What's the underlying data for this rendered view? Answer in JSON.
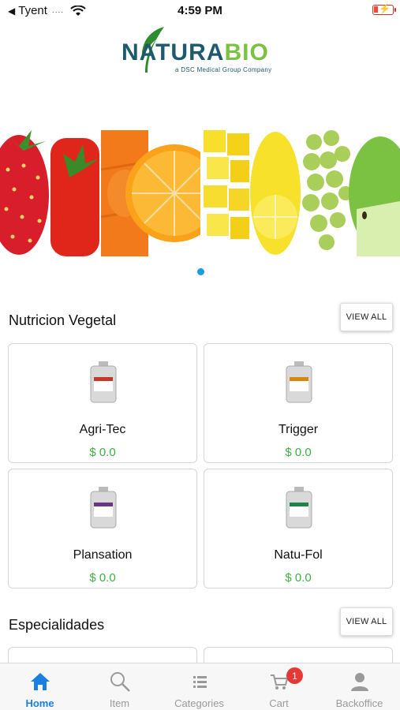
{
  "status_bar": {
    "carrier": "Tyent",
    "signal_dots": "....",
    "time": "4:59 PM"
  },
  "logo": {
    "brand_left": "NATURA",
    "brand_right": "BIO",
    "tagline": "a DSC Medical Group Company",
    "colors": {
      "primary": "#1d5a6e",
      "accent": "#7cc242"
    }
  },
  "banner": {
    "icon": "fruit-banner-image",
    "slides_total": 1,
    "active_slide": 1
  },
  "sections": [
    {
      "title": "Nutricion Vegetal",
      "view_all_label": "VIEW ALL",
      "products": [
        {
          "name": "Agri-Tec",
          "price": "$ 0.0",
          "label_color": "#c0392b"
        },
        {
          "name": "Trigger",
          "price": "$ 0.0",
          "label_color": "#d68910"
        },
        {
          "name": "Plansation",
          "price": "$ 0.0",
          "label_color": "#6c3483"
        },
        {
          "name": "Natu-Fol",
          "price": "$ 0.0",
          "label_color": "#1e8449"
        }
      ]
    },
    {
      "title": "Especialidades",
      "view_all_label": "VIEW ALL",
      "products": []
    }
  ],
  "tab_bar": {
    "active_color": "#1a7fe0",
    "tabs": [
      {
        "label": "Home",
        "icon": "home-icon",
        "active": true
      },
      {
        "label": "Item",
        "icon": "search-icon",
        "active": false
      },
      {
        "label": "Categories",
        "icon": "list-icon",
        "active": false
      },
      {
        "label": "Cart",
        "icon": "cart-icon",
        "active": false,
        "badge": "1"
      },
      {
        "label": "Backoffice",
        "icon": "person-icon",
        "active": false
      }
    ]
  }
}
